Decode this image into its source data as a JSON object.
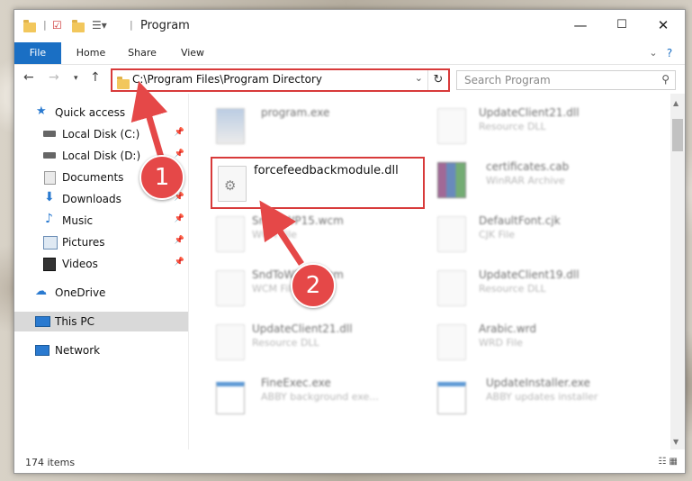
{
  "window": {
    "title": "Program"
  },
  "ribbon": {
    "tabs": [
      "File",
      "Home",
      "Share",
      "View"
    ],
    "help": "?"
  },
  "address": {
    "path": "C:\\Program Files\\Program Directory"
  },
  "search": {
    "placeholder": "Search Program"
  },
  "nav": {
    "items": [
      {
        "label": "Quick access"
      },
      {
        "label": "Local Disk (C:)"
      },
      {
        "label": "Local Disk (D:)"
      },
      {
        "label": "Documents"
      },
      {
        "label": "Downloads"
      },
      {
        "label": "Music"
      },
      {
        "label": "Pictures"
      },
      {
        "label": "Videos"
      },
      {
        "label": "OneDrive"
      },
      {
        "label": "This PC"
      },
      {
        "label": "Network"
      }
    ]
  },
  "files": [
    {
      "name": "program.exe",
      "type": ""
    },
    {
      "name": "UpdateClient21.dll",
      "type": "Resource DLL"
    },
    {
      "name": "certificates.cab",
      "type": "WinRAR Archive"
    },
    {
      "name": "SndToWP15.wcm",
      "type": "WCM File"
    },
    {
      "name": "DefaultFont.cjk",
      "type": "CJK File"
    },
    {
      "name": "SndToWP15.wcm",
      "type": "WCM File"
    },
    {
      "name": "UpdateClient19.dll",
      "type": "Resource DLL"
    },
    {
      "name": "UpdateClient21.dll",
      "type": "Resource DLL"
    },
    {
      "name": "Arabic.wrd",
      "type": "WRD File"
    },
    {
      "name": "FineExec.exe",
      "type": "ABBY background exe..."
    },
    {
      "name": "UpdateInstaller.exe",
      "type": "ABBY updates installer"
    }
  ],
  "highlighted": {
    "name": "forcefeedbackmodule.dll"
  },
  "status": {
    "count": "174 items"
  },
  "callouts": [
    "1",
    "2"
  ],
  "colors": {
    "accent": "#1a6fc4",
    "callout": "#e54848",
    "highlight_border": "#d83a3a"
  }
}
